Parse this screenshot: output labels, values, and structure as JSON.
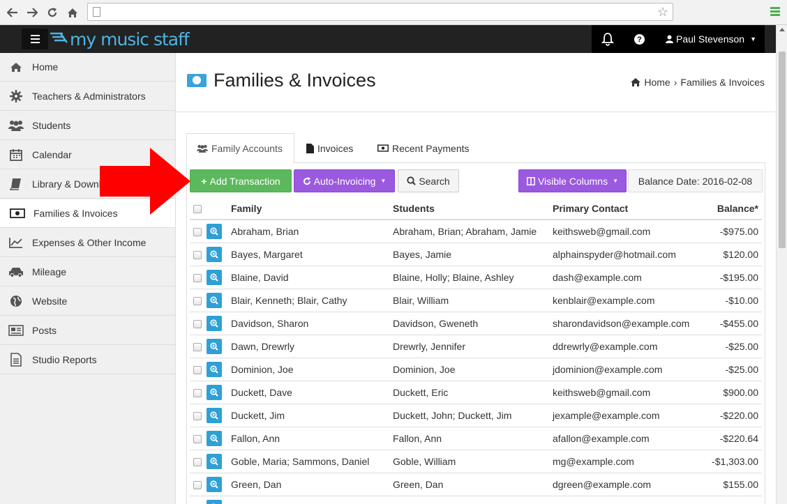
{
  "browser": {
    "url": ""
  },
  "header": {
    "logo_text": "my music staff",
    "user_name": "Paul Stevenson",
    "help_label": "?"
  },
  "sidebar": {
    "items": [
      {
        "label": "Home",
        "icon": "home-icon"
      },
      {
        "label": "Teachers & Administrators",
        "icon": "gear-icon"
      },
      {
        "label": "Students",
        "icon": "users-icon"
      },
      {
        "label": "Calendar",
        "icon": "calendar-icon"
      },
      {
        "label": "Library & Downloads",
        "icon": "book-icon"
      },
      {
        "label": "Families & Invoices",
        "icon": "money-icon",
        "active": true
      },
      {
        "label": "Expenses & Other Income",
        "icon": "line-chart-icon"
      },
      {
        "label": "Mileage",
        "icon": "car-icon"
      },
      {
        "label": "Website",
        "icon": "globe-icon"
      },
      {
        "label": "Posts",
        "icon": "newspaper-icon"
      },
      {
        "label": "Studio Reports",
        "icon": "report-icon"
      }
    ]
  },
  "page": {
    "title": "Families & Invoices",
    "breadcrumb_home": "Home",
    "breadcrumb_sep": "›",
    "breadcrumb_current": "Families & Invoices"
  },
  "tabs": [
    {
      "label": "Family Accounts",
      "icon": "users-icon",
      "active": true
    },
    {
      "label": "Invoices",
      "icon": "file-icon"
    },
    {
      "label": "Recent Payments",
      "icon": "money-icon"
    }
  ],
  "toolbar": {
    "add_transaction": "Add Transaction",
    "auto_invoicing": "Auto-Invoicing",
    "search": "Search",
    "visible_columns": "Visible Columns",
    "balance_date": "Balance Date: 2016-02-08"
  },
  "table": {
    "headers": {
      "family": "Family",
      "students": "Students",
      "contact": "Primary Contact",
      "balance": "Balance*"
    },
    "rows": [
      {
        "family": "Abraham, Brian",
        "students": "Abraham, Brian; Abraham, Jamie",
        "contact": "keithsweb@gmail.com",
        "balance": "-$975.00"
      },
      {
        "family": "Bayes, Margaret",
        "students": "Bayes, Jamie",
        "contact": "alphainspyder@hotmail.com",
        "balance": "$120.00"
      },
      {
        "family": "Blaine, David",
        "students": "Blaine, Holly; Blaine, Ashley",
        "contact": "dash@example.com",
        "balance": "-$195.00"
      },
      {
        "family": "Blair, Kenneth; Blair, Cathy",
        "students": "Blair, William",
        "contact": "kenblair@example.com",
        "balance": "-$10.00"
      },
      {
        "family": "Davidson, Sharon",
        "students": "Davidson, Gweneth",
        "contact": "sharondavidson@example.com",
        "balance": "-$455.00"
      },
      {
        "family": "Dawn, Drewrly",
        "students": "Drewrly, Jennifer",
        "contact": "ddrewrly@example.com",
        "balance": "-$25.00"
      },
      {
        "family": "Dominion, Joe",
        "students": "Dominion, Joe",
        "contact": "jdominion@example.com",
        "balance": "-$25.00"
      },
      {
        "family": "Duckett, Dave",
        "students": "Duckett, Eric",
        "contact": "keithsweb@gmail.com",
        "balance": "$900.00"
      },
      {
        "family": "Duckett, Jim",
        "students": "Duckett, John; Duckett, Jim",
        "contact": "jexample@example.com",
        "balance": "-$220.00"
      },
      {
        "family": "Fallon, Ann",
        "students": "Fallon, Ann",
        "contact": "afallon@example.com",
        "balance": "-$220.64"
      },
      {
        "family": "Goble, Maria; Sammons, Daniel",
        "students": "Goble, William",
        "contact": "mg@example.com",
        "balance": "-$1,303.00"
      },
      {
        "family": "Green, Dan",
        "students": "Green, Dan",
        "contact": "dgreen@example.com",
        "balance": "$155.00"
      },
      {
        "family": "",
        "students": "",
        "contact": "",
        "balance": ""
      }
    ]
  },
  "colors": {
    "accent_blue": "#3aa3d9",
    "green_button": "#5cb85c",
    "purple_button": "#9b59e0",
    "annotation_arrow": "#ff0000"
  }
}
